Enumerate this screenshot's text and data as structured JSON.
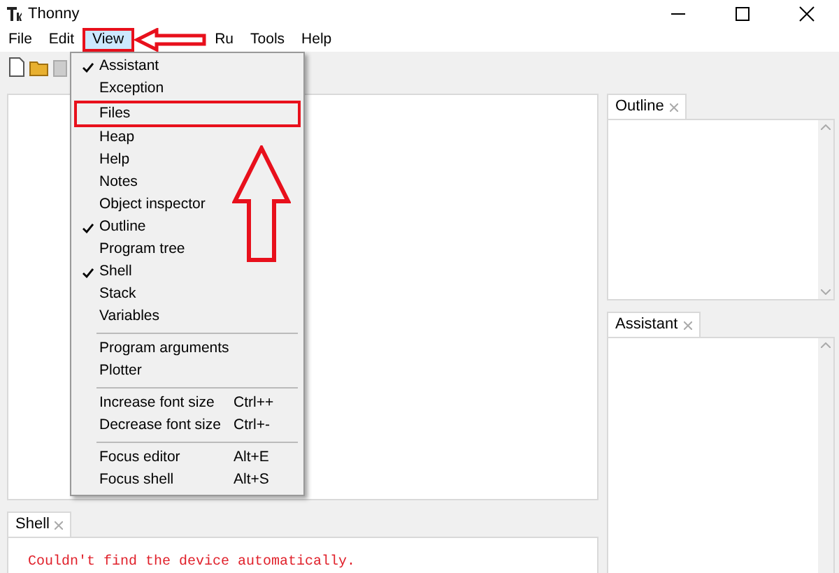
{
  "window": {
    "title": "Thonny"
  },
  "menu_bar": [
    {
      "label": "File",
      "selected": false,
      "annotated": false
    },
    {
      "label": "Edit",
      "selected": false,
      "annotated": false
    },
    {
      "label": "View",
      "selected": true,
      "annotated": true
    },
    {
      "label": "Ru",
      "selected": false,
      "annotated": false
    },
    {
      "label": "Tools",
      "selected": false,
      "annotated": false
    },
    {
      "label": "Help",
      "selected": false,
      "annotated": false
    }
  ],
  "view_menu": [
    [
      {
        "label": "Assistant",
        "checked": true,
        "annotated": false
      },
      {
        "label": "Exception",
        "checked": false,
        "annotated": false
      },
      {
        "label": "Files",
        "checked": false,
        "annotated": true
      },
      {
        "label": "Heap",
        "checked": false,
        "annotated": false
      },
      {
        "label": "Help",
        "checked": false,
        "annotated": false
      },
      {
        "label": "Notes",
        "checked": false,
        "annotated": false
      },
      {
        "label": "Object inspector",
        "checked": false,
        "annotated": false
      },
      {
        "label": "Outline",
        "checked": true,
        "annotated": false
      },
      {
        "label": "Program tree",
        "checked": false,
        "annotated": false
      },
      {
        "label": "Shell",
        "checked": true,
        "annotated": false
      },
      {
        "label": "Stack",
        "checked": false,
        "annotated": false
      },
      {
        "label": "Variables",
        "checked": false,
        "annotated": false
      }
    ],
    [
      {
        "label": "Program arguments"
      },
      {
        "label": "Plotter"
      }
    ],
    [
      {
        "label": "Increase font size",
        "shortcut": "Ctrl++"
      },
      {
        "label": "Decrease font size",
        "shortcut": "Ctrl+-"
      }
    ],
    [
      {
        "label": "Focus editor",
        "shortcut": "Alt+E"
      },
      {
        "label": "Focus shell",
        "shortcut": "Alt+S"
      }
    ]
  ],
  "outline": {
    "tab": "Outline"
  },
  "assistant": {
    "tab": "Assistant"
  },
  "shell": {
    "tab": "Shell",
    "output": "Couldn't find the device automatically."
  }
}
